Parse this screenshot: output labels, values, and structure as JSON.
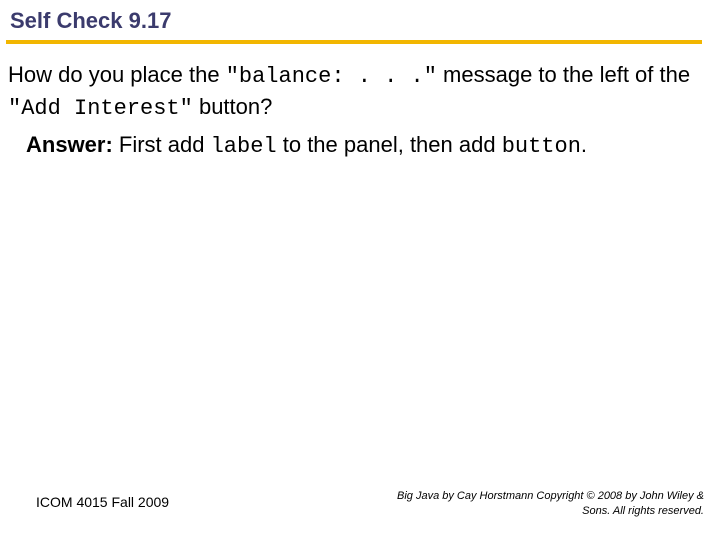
{
  "title": "Self Check 9.17",
  "question": {
    "q1a": "How do you place the ",
    "q1code1": "\"balance: . . .\"",
    "q1b": " message to the left of the ",
    "q1code2": "\"Add Interest\"",
    "q1c": " button?"
  },
  "answer": {
    "label": "Answer:",
    "a1": " First add ",
    "code1": "label",
    "a2": " to the panel, then add ",
    "code2": "button",
    "a3": "."
  },
  "footer": {
    "left": "ICOM 4015 Fall 2009",
    "right": "Big Java by Cay Horstmann Copyright © 2008 by John Wiley & Sons.  All rights reserved."
  }
}
